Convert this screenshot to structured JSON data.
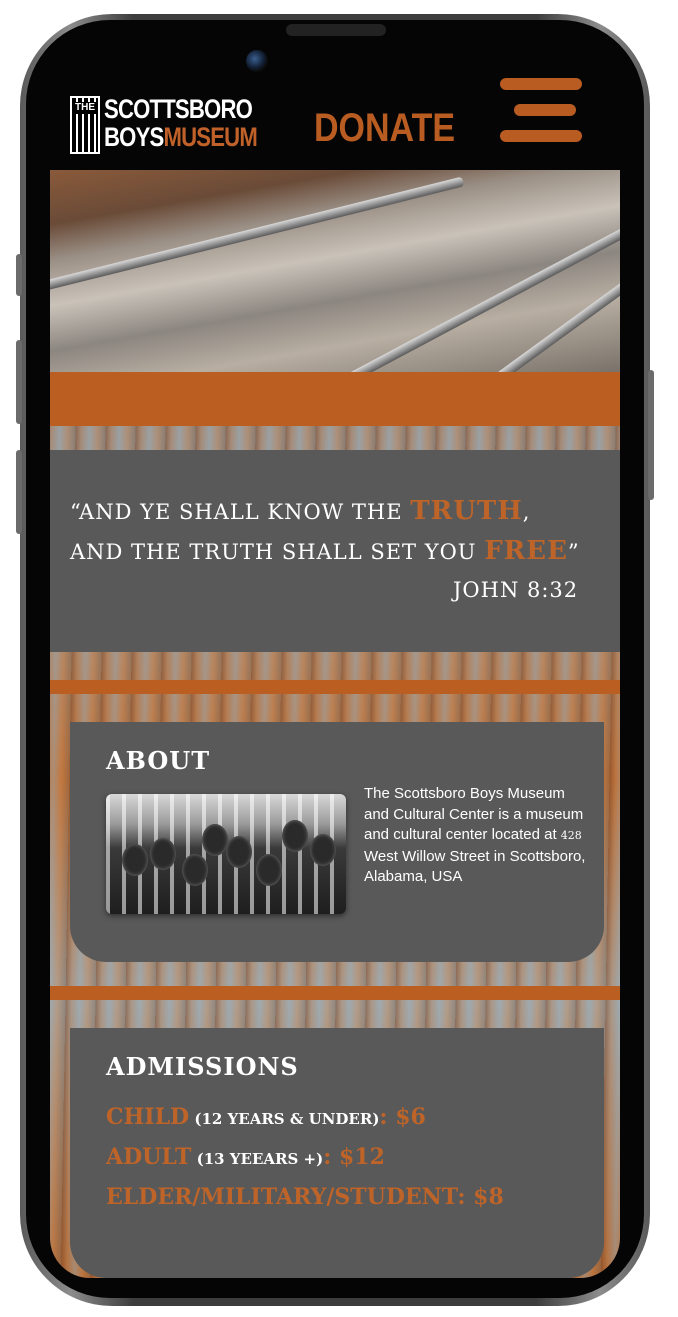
{
  "header": {
    "logo": {
      "the": "THE",
      "line1": "SCOTTSBORO",
      "line2_a": "BOYS",
      "line2_b": "MUSEUM"
    },
    "donate_label": "DONATE",
    "menu_icon": "hamburger-menu-icon"
  },
  "quote": {
    "line1_a": "“AND YE SHALL KNOW THE ",
    "line1_hl": "TRUTH",
    "line1_b": ",",
    "line2_a": "AND THE TRUTH SHALL SET YOU ",
    "line2_hl": "FREE",
    "line2_b": "”",
    "citation": "JOHN 8:32"
  },
  "about": {
    "title": "ABOUT",
    "text_a": "The Scottsboro Boys Museum and Cultural Center is a museum and cultural center located at ",
    "text_num": "428",
    "text_b": " West Willow Street in Scottsboro, Alabama, USA"
  },
  "admissions": {
    "title": "ADMISSIONS",
    "rows": [
      {
        "label": "CHILD",
        "note": " (12 YEARS & UNDER)",
        "price": ": $6"
      },
      {
        "label": "ADULT",
        "note": " (13 YEEARS +)",
        "price": ": $12"
      },
      {
        "label": "ELDER/MILITARY/STUDENT: $8",
        "note": "",
        "price": ""
      }
    ]
  },
  "colors": {
    "accent": "#bb5e22",
    "card": "#595959",
    "bezel": "#050505"
  }
}
